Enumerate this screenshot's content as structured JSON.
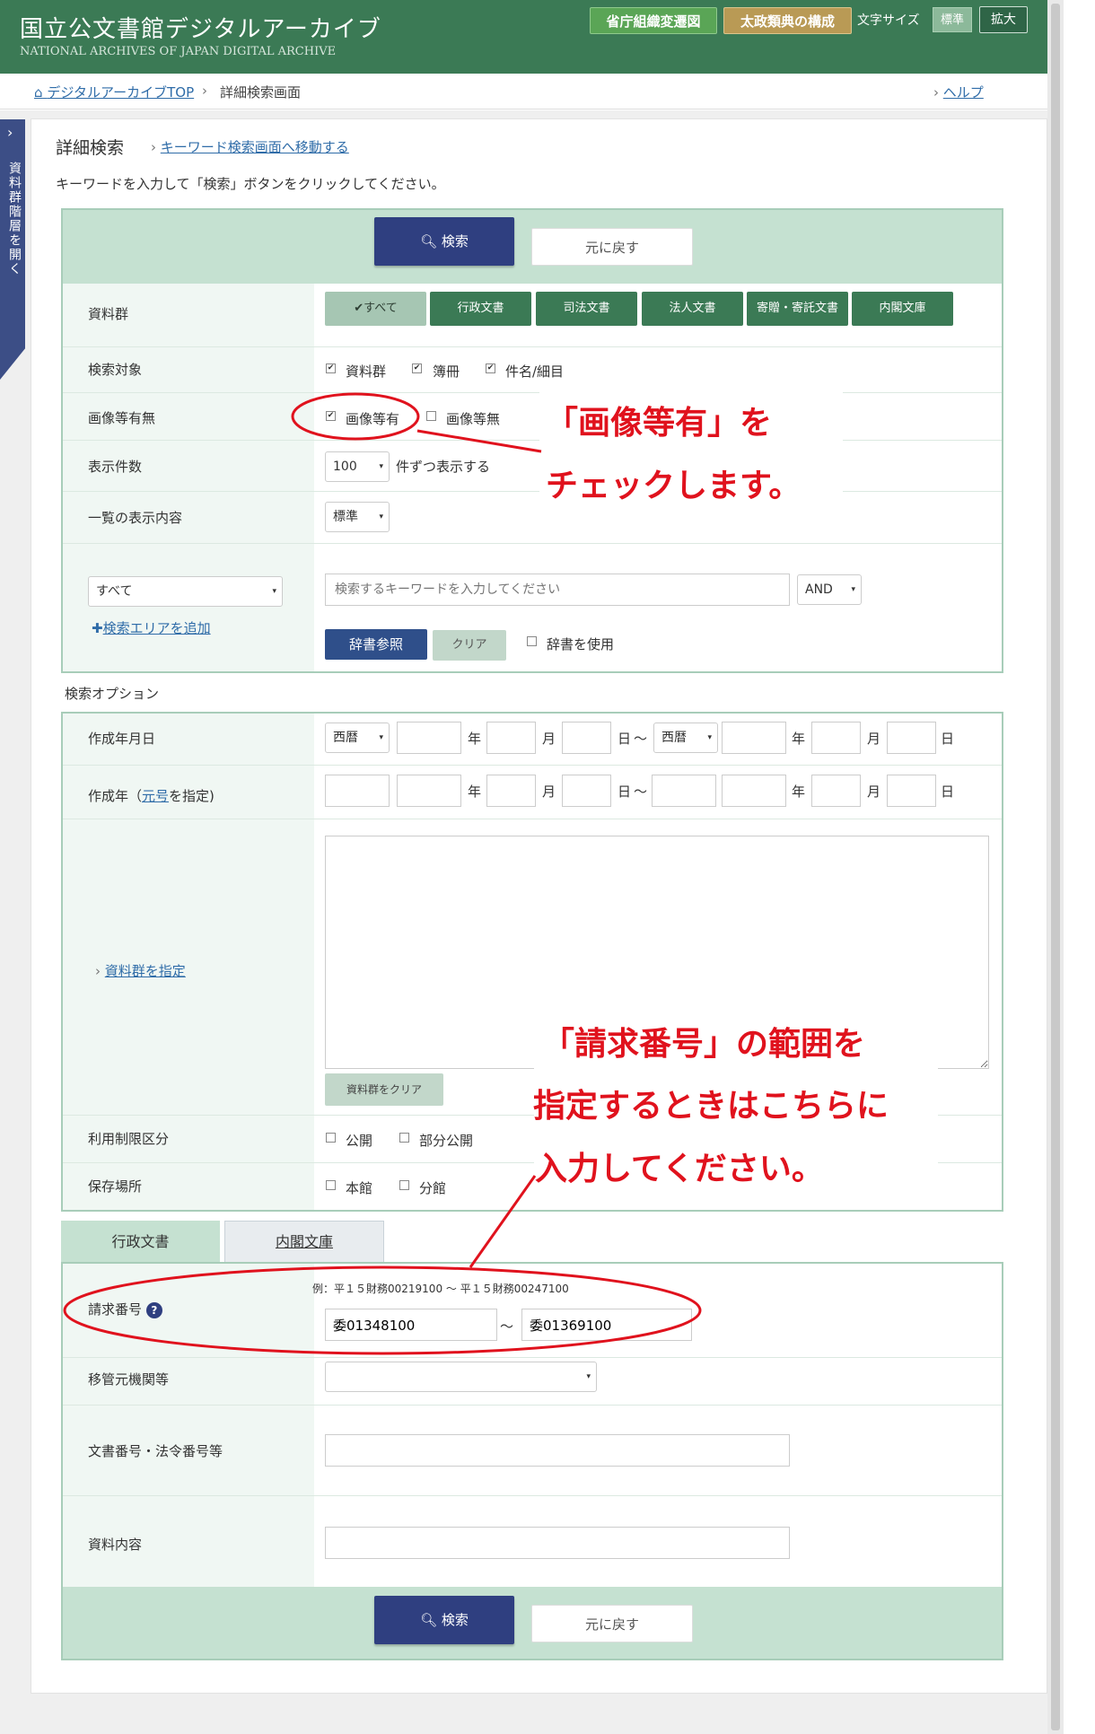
{
  "header": {
    "title_jp": "国立公文書館デジタルアーカイブ",
    "title_en": "NATIONAL ARCHIVES OF JAPAN  DIGITAL ARCHIVE",
    "btn_org_chart": "省庁組織変遷図",
    "btn_dajo": "太政類典の構成",
    "font_size_label": "文字サイズ",
    "font_std": "標準",
    "font_large": "拡大"
  },
  "breadcrumb": {
    "home": "デジタルアーカイブTOP",
    "sep": "›",
    "current": "詳細検索画面",
    "help": "ヘルプ"
  },
  "sidebar": {
    "arrow": "›",
    "label": "資料群階層を開く"
  },
  "page": {
    "title": "詳細検索",
    "keyword_link": "キーワード検索画面へ移動する",
    "instruction": "キーワードを入力して「検索」ボタンをクリックしてください。"
  },
  "actions": {
    "search": "検索",
    "reset": "元に戻す"
  },
  "groups": {
    "label": "資料群",
    "items": [
      "✔すべて",
      "行政文書",
      "司法文書",
      "法人文書",
      "寄贈・寄託文書",
      "内閣文庫"
    ]
  },
  "target": {
    "label": "検索対象",
    "options": [
      "資料群",
      "簿冊",
      "件名/細目"
    ]
  },
  "image": {
    "label": "画像等有無",
    "opt_yes": "画像等有",
    "opt_no": "画像等無"
  },
  "count": {
    "label": "表示件数",
    "value": "100",
    "suffix": "件ずつ表示する"
  },
  "display": {
    "label": "一覧の表示内容",
    "value": "標準"
  },
  "keyword": {
    "scope": "すべて",
    "placeholder": "検索するキーワードを入力してください",
    "op": "AND",
    "add_area": "検索エリアを追加",
    "dict_btn": "辞書参照",
    "clear_btn": "クリア",
    "use_dict": "辞書を使用"
  },
  "options_title": "検索オプション",
  "date": {
    "label": "作成年月日",
    "era": "西暦",
    "year": "年",
    "month": "月",
    "day": "日",
    "tilde": "〜"
  },
  "year": {
    "label_pre": "作成年（",
    "label_link": "元号",
    "label_post": "を指定)"
  },
  "groups_spec": {
    "link": "資料群を指定",
    "clear_btn": "資料群をクリア"
  },
  "restriction": {
    "label": "利用制限区分",
    "opt1": "公開",
    "opt2": "部分公開"
  },
  "location": {
    "label": "保存場所",
    "opt1": "本館",
    "opt2": "分館"
  },
  "tabs": [
    "行政文書",
    "内閣文庫"
  ],
  "request": {
    "label": "請求番号",
    "example": "例：平１５財務00219100 〜 平１５財務00247100",
    "from": "委01348100",
    "tilde": "〜",
    "to": "委01369100"
  },
  "transfer": {
    "label": "移管元機関等"
  },
  "docno": {
    "label": "文書番号・法令番号等"
  },
  "content": {
    "label": "資料内容"
  },
  "annotations": {
    "a1_line1": "「画像等有」を",
    "a1_line2": "チェックします。",
    "a2_line1": "「請求番号」の範囲を",
    "a2_line2": "指定するときはこちらに",
    "a2_line3": "入力してください。"
  }
}
